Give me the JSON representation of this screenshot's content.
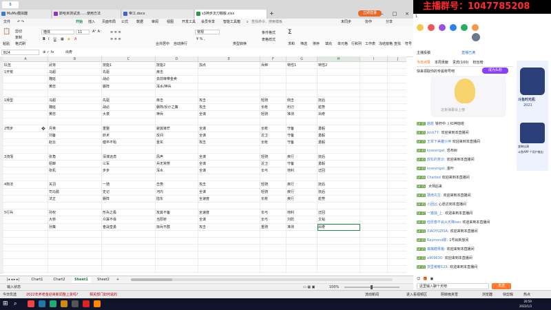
{
  "browser_tabs": [
    {
      "label": "MuMu模拟器",
      "active": false,
      "color": "#3a7bd5"
    },
    {
      "label": "斯哈米测试流……使用方法",
      "active": false,
      "color": "#9a2fc4"
    },
    {
      "label": "帝江.docx",
      "active": false,
      "color": "#3b63c9"
    },
    {
      "label": "s3神步法刀棚版.xlsx",
      "active": true,
      "color": "#1f9e4d"
    }
  ],
  "login_button": "立即登录",
  "menu": {
    "file": "文件",
    "items": [
      "开始",
      "插入",
      "页面布局",
      "公式",
      "数据",
      "审阅",
      "视图",
      "开发工具",
      "会员专享",
      "智能工具箱"
    ],
    "active_index": 0,
    "search": "查找命令、搜索模板",
    "cloud": "未同步",
    "collab": "协作",
    "share": "分享"
  },
  "ribbon": {
    "paste": "粘贴",
    "cut": "剪切",
    "copy": "复制",
    "format_painter": "格式刷",
    "font": "楷体",
    "size": "11",
    "merge": "合并居中",
    "wrap": "自动换行",
    "number_format": "常规",
    "cond_format": "条件格式",
    "table_style": "表格样式",
    "sum": "求和",
    "filter": "筛选",
    "sort": "排序",
    "fill": "填充",
    "cells": "单元格",
    "rows": "行和列",
    "sheet": "工作表",
    "freeze": "冻结窗格",
    "find": "查找",
    "symbol": "符号",
    "type_convert": "类型转换"
  },
  "formula_bar": {
    "cell_ref": "B24",
    "value": "出奇"
  },
  "columns": [
    "A",
    "B",
    "C",
    "D",
    "E",
    "F",
    "G",
    "H",
    "I",
    "J"
  ],
  "selected_column": "H",
  "rows": [
    [
      "队伍",
      "武将",
      "技能1",
      "技能2",
      "加点",
      "兵种",
      "特性1",
      "特性2",
      "",
      ""
    ],
    [
      "1开荒",
      "马超",
      "先驱",
      "疾击",
      "",
      "",
      "",
      "",
      "",
      ""
    ],
    [
      "",
      "魏延",
      "战必",
      "去前锋带金卖",
      "",
      "",
      "",
      "",
      "",
      ""
    ],
    [
      "",
      "黄忠",
      "磐阵",
      "浑水/神兵",
      "",
      "",
      "",
      "",
      "",
      ""
    ],
    [
      "",
      "",
      "",
      "",
      "",
      "",
      "",
      "",
      "",
      ""
    ],
    [
      "1拜型",
      "马超",
      "先驱",
      "疾击",
      "攻击",
      "轻骑",
      "侧击",
      "抚后",
      "",
      ""
    ],
    [
      "",
      "魏延",
      "战必",
      "磐阵/反计之策",
      "攻击",
      "长枪",
      "利刃",
      "趁势",
      "",
      ""
    ],
    [
      "",
      "黄忠",
      "大衰",
      "神兵",
      "全谋",
      "轻骑",
      "准测",
      "出奇",
      "",
      ""
    ],
    [
      "",
      "",
      "",
      "",
      "",
      "",
      "",
      "",
      "",
      ""
    ],
    [
      "2弩步",
      "月英",
      "重整",
      "避其锋芒",
      "全谋",
      "长枪",
      "守备",
      "勇毅",
      "",
      ""
    ],
    [
      "",
      "刘备",
      "妖术",
      "反间",
      "全谋",
      "近卫",
      "守备",
      "勇毅",
      "",
      ""
    ],
    [
      "",
      "赵云",
      "健卒不殆",
      "金实",
      "攻击",
      "长枪",
      "守备",
      "勇毅",
      "",
      ""
    ],
    [
      "",
      "",
      "",
      "",
      "",
      "",
      "",
      "",
      "",
      ""
    ],
    [
      "3流氓",
      "张角",
      "深谋远虑",
      "风声",
      "全谋",
      "轻骑",
      "疾行",
      "抚后",
      "",
      ""
    ],
    [
      "",
      "貂蝉",
      "三军",
      "兵无常势",
      "全谋",
      "近卫",
      "守备",
      "勇毅",
      "",
      ""
    ],
    [
      "",
      "张机",
      "步步",
      "浑水",
      "全谋",
      "长弓",
      "地利",
      "迂回",
      "",
      ""
    ],
    [
      "",
      "",
      "",
      "",
      "",
      "",
      "",
      "",
      "",
      ""
    ],
    [
      "4狗法",
      "关羽",
      "一骑",
      "击势",
      "攻击",
      "轻骑",
      "疾行",
      "抚后",
      "",
      ""
    ],
    [
      "",
      "司马懿",
      "史记",
      "河内",
      "全谋",
      "轻骑",
      "疾行",
      "抚后",
      "",
      ""
    ],
    [
      "",
      "法正",
      "磐阵",
      "陆东",
      "全速度",
      "长枪",
      "疾行",
      "趁势",
      "",
      ""
    ],
    [
      "",
      "",
      "",
      "",
      "",
      "",
      "",
      "",
      "",
      ""
    ],
    [
      "5行兵",
      "孙权",
      "形兵之极",
      "攻其不备",
      "全速度",
      "长弓",
      "地利",
      "迂回",
      "",
      ""
    ],
    [
      "",
      "大桥",
      "众寡不侔",
      "当阳桥",
      "全谋",
      "长弓",
      "刘防",
      "文韬",
      "",
      ""
    ],
    [
      "",
      "孙策",
      "奋战皇勇",
      "掠兵不群",
      "攻击",
      "重骑",
      "准测",
      "出奇",
      "",
      ""
    ]
  ],
  "sheet_tabs": [
    "Chart1",
    "Chart2",
    "Sheet1",
    "Sheet2"
  ],
  "active_sheet": "Sheet1",
  "status": {
    "mode": "输入状态",
    "zoom": "100%"
  },
  "taskbar_items": [
    "今日优选",
    "2022年养老金迎来新调整上涨吗?",
    "相关部门如何说的",
    "流动新闻",
    "进入看视频区",
    "新闻",
    "浏览器",
    "快剪辑",
    "热点",
    "加速器"
  ],
  "weather": "阴转雨夹雪",
  "live": {
    "banner": "主播群号：1047785208",
    "counter": "1",
    "tabs": [
      "今日点赞",
      "本周贡献",
      "贵宾(100)",
      "粉丝榜"
    ],
    "followed": "主播投稿",
    "label": "直播已满",
    "badge": "成为头粉",
    "intro": "快来领取你的专属称号吧",
    "welcome": "这条弹幕会上榜",
    "chat": [
      {
        "lv": "LV 31",
        "user": "菇菇",
        "text": "铁杆中 :) 红神炮塔"
      },
      {
        "lv": "LV 35",
        "user": "jknb77:",
        "text": "欢迎来到本直播间"
      },
      {
        "lv": "LV 15",
        "user": "王翠下美雕沙神",
        "text": "欢迎来到本直播间"
      },
      {
        "lv": "LV 45",
        "user": "lovesingel:",
        "text": "恐布树"
      },
      {
        "lv": "LV 45",
        "user": "放松的意识:",
        "text": "欢迎来到本直播间"
      },
      {
        "lv": "LV 45",
        "user": "lovesingel:",
        "text": "金叶"
      },
      {
        "lv": "LV 20",
        "user": "Chatted",
        "text": "欢迎来到本直播间"
      },
      {
        "lv": "LV 15",
        "user": "",
        "text": "大师后来"
      },
      {
        "lv": "LV 45",
        "user": "蒲滴先生:",
        "text": "欢迎来到本直播间"
      },
      {
        "lv": "LV 45",
        "user": "小团凶",
        "text": "心愿达到本直播间"
      },
      {
        "lv": "LV 37",
        "user": "一猫独_上:",
        "text": "欢迎来到本直播间"
      },
      {
        "lv": "LV 45",
        "user": "但愿春不会从天降ben",
        "text": "欢迎来到本直播间"
      },
      {
        "lv": "LV 15",
        "user": "XIAOYUZISA:",
        "text": "欢迎来到本直播间"
      },
      {
        "lv": "LV 45",
        "user": "Raymond碟:",
        "text": "1号出新放间"
      },
      {
        "lv": "LV 25",
        "user": "嘴嘴糖果猪:",
        "text": "欢迎来到本直播间"
      },
      {
        "lv": "LV 35",
        "user": "a909630:",
        "text": "欢迎来到本直播间"
      },
      {
        "lv": "LV 15",
        "user": "流里嘟嘟123:",
        "text": "欢迎来到本直播间"
      }
    ],
    "input_placeholder": "这里输入聊个天吧",
    "send": "发送",
    "event_title": "斗鱼时光机",
    "event_year": "2021",
    "event_sub": "变映出演",
    "event_sub2": "斗鱼APP 个用户推出",
    "clock_time": "20:59",
    "clock_date": "2022/1/3"
  }
}
